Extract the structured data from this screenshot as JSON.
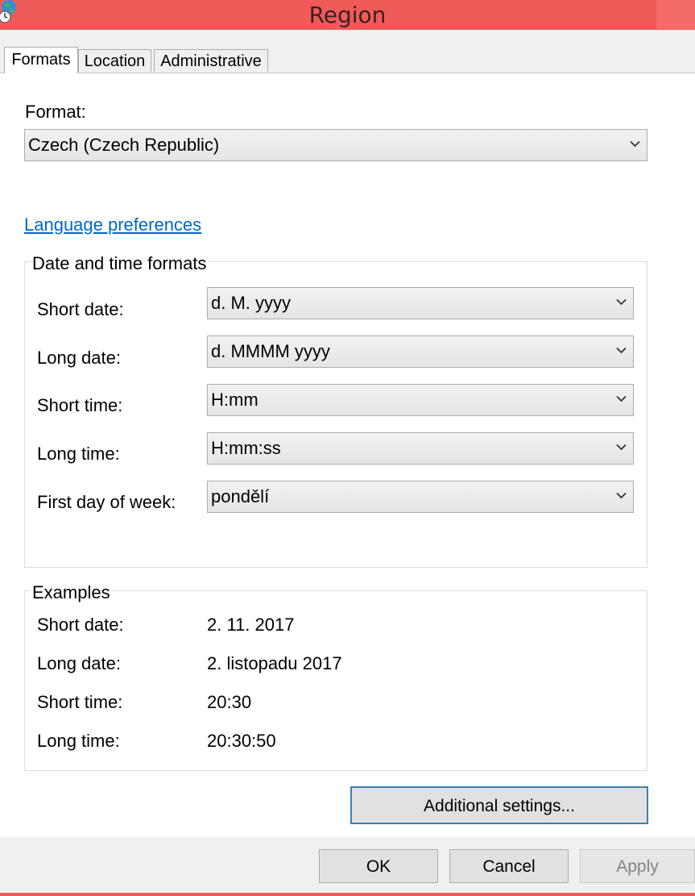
{
  "window": {
    "title": "Region"
  },
  "tabs": [
    {
      "label": "Formats",
      "active": true
    },
    {
      "label": "Location",
      "active": false
    },
    {
      "label": "Administrative",
      "active": false
    }
  ],
  "formats": {
    "format_label": "Format:",
    "format_value": "Czech (Czech Republic)",
    "language_link": "Language preferences",
    "date_time_group": {
      "title": "Date and time formats",
      "rows": [
        {
          "label": "Short date:",
          "value": "d. M. yyyy"
        },
        {
          "label": "Long date:",
          "value": "d. MMMM yyyy"
        },
        {
          "label": "Short time:",
          "value": "H:mm"
        },
        {
          "label": "Long time:",
          "value": "H:mm:ss"
        },
        {
          "label": "First day of week:",
          "value": "pondělí"
        }
      ]
    },
    "examples_group": {
      "title": "Examples",
      "rows": [
        {
          "label": "Short date:",
          "value": "2. 11. 2017"
        },
        {
          "label": "Long date:",
          "value": "2. listopadu 2017"
        },
        {
          "label": "Short time:",
          "value": "20:30"
        },
        {
          "label": "Long time:",
          "value": "20:30:50"
        }
      ]
    },
    "additional_settings_label": "Additional settings..."
  },
  "footer": {
    "ok_label": "OK",
    "cancel_label": "Cancel",
    "apply_label": "Apply"
  },
  "colors": {
    "titlebar": "#f05a58",
    "link": "#0066cc",
    "default_button_border": "#3c7fb1"
  }
}
